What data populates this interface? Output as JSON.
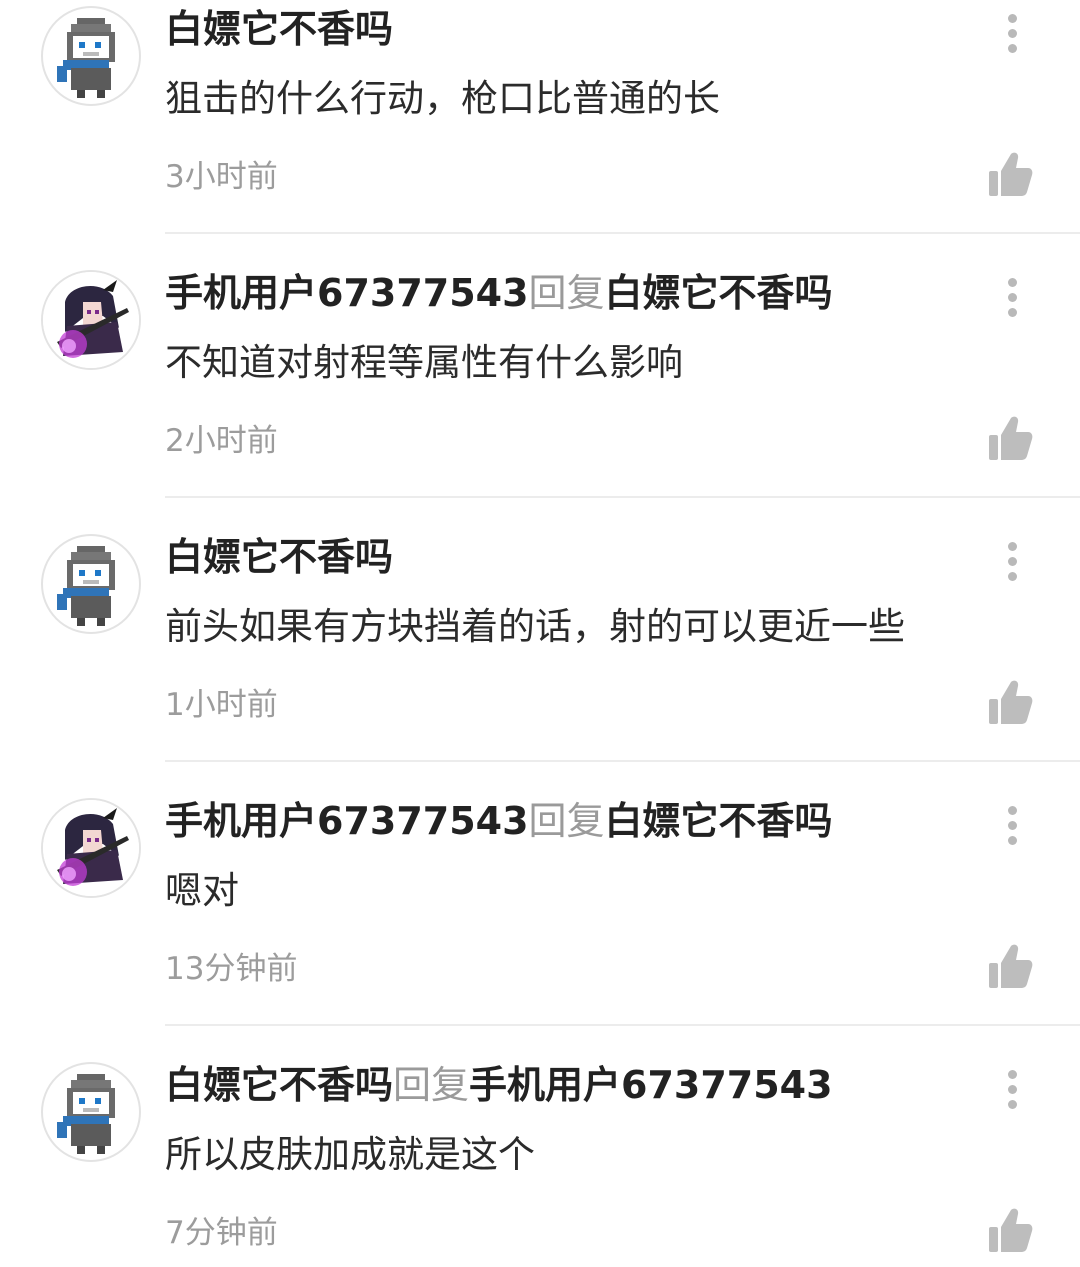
{
  "comments": [
    {
      "author": "白嫖它不香吗",
      "reply_word": "",
      "reply_to": "",
      "text": "狙击的什么行动，枪口比普通的长",
      "time": "3小时前",
      "avatar": "ghost-knight-avatar"
    },
    {
      "author": "手机用户67377543",
      "reply_word": "回复",
      "reply_to": "白嫖它不香吗",
      "text": "不知道对射程等属性有什么影响",
      "time": "2小时前",
      "avatar": "anime-girl-avatar"
    },
    {
      "author": "白嫖它不香吗",
      "reply_word": "",
      "reply_to": "",
      "text": "前头如果有方块挡着的话，射的可以更近一些",
      "time": "1小时前",
      "avatar": "ghost-knight-avatar"
    },
    {
      "author": "手机用户67377543",
      "reply_word": "回复",
      "reply_to": "白嫖它不香吗",
      "text": "嗯对",
      "time": "13分钟前",
      "avatar": "anime-girl-avatar"
    },
    {
      "author": "白嫖它不香吗",
      "reply_word": "回复",
      "reply_to": "手机用户67377543",
      "text": "所以皮肤加成就是这个",
      "time": "7分钟前",
      "avatar": "ghost-knight-avatar"
    }
  ],
  "icons": {
    "more": "more-vertical-icon",
    "like": "thumbs-up-icon"
  },
  "colors": {
    "author": "#222222",
    "reply_word": "#9a9a9a",
    "timestamp": "#9c9c9c",
    "icon": "#b9b9b9",
    "divider": "#ececec"
  }
}
